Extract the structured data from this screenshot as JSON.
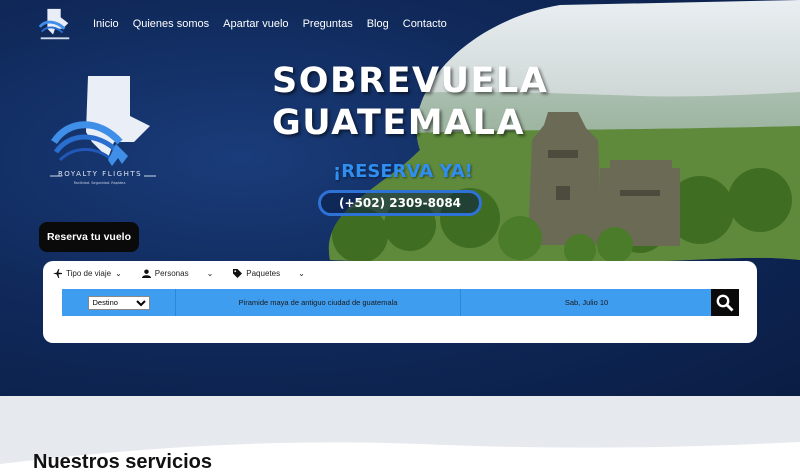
{
  "nav": {
    "items": [
      "Inicio",
      "Quienes somos",
      "Apartar vuelo",
      "Preguntas",
      "Blog",
      "Contacto"
    ]
  },
  "brand": {
    "name": "ROYALTY FLIGHTS",
    "tagline": "Facilidad. Seguridad. Rapidez."
  },
  "hero": {
    "title_line1": "SOBREVUELA",
    "title_line2": "GUATEMALA",
    "reserve_text": "¡RESERVA YA!",
    "phone": "(+502) 2309-8084",
    "cta_button": "Reserva tu vuelo"
  },
  "search": {
    "tabs": [
      {
        "label": "Tipo de viaje",
        "icon": "plane-icon"
      },
      {
        "label": "Personas",
        "icon": "person-icon"
      },
      {
        "label": "Paquetes",
        "icon": "tag-icon"
      }
    ],
    "destination_selected": "Destino",
    "description": "Piramide maya de antiguo ciudad de guatemala",
    "date": "Sab, Julio 10",
    "search_icon": "search-icon"
  },
  "sections": {
    "services_title": "Nuestros servicios"
  },
  "colors": {
    "hero_bg": "#0f2a5c",
    "accent_blue": "#3f9df0",
    "reserve_blue": "#2f8ef0",
    "dark_button": "#0a0a0a"
  }
}
